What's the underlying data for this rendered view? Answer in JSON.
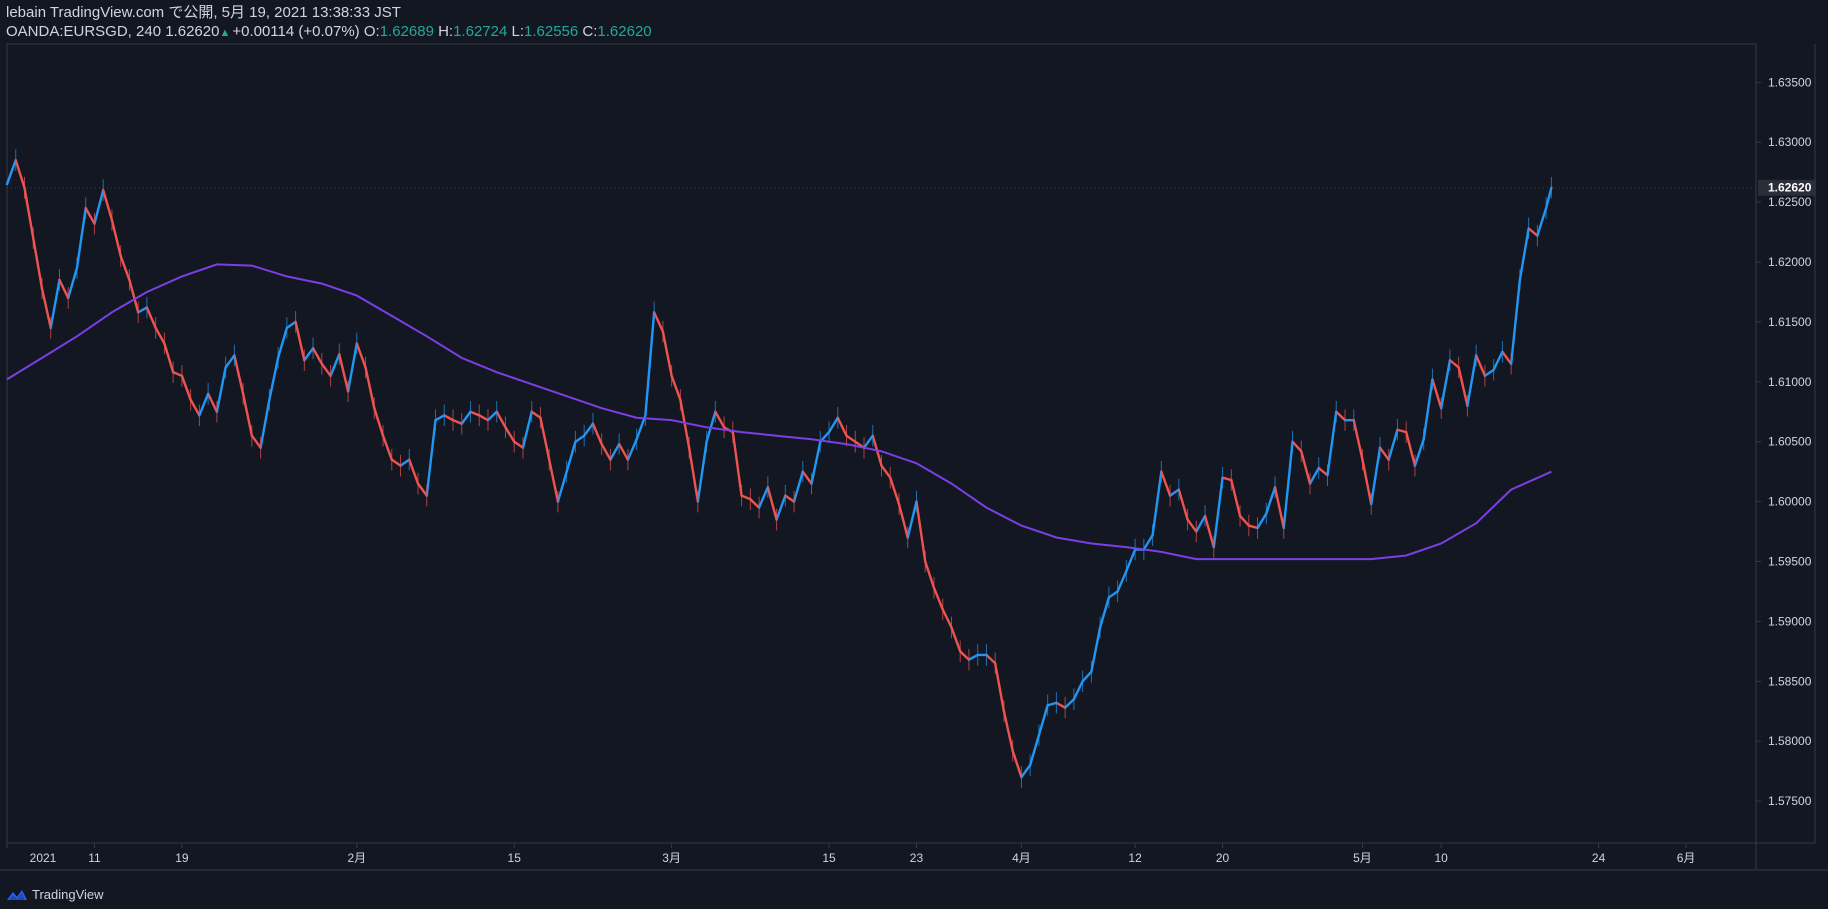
{
  "header": {
    "published_line": "lebain TradingView.com で公開, 5月 19, 2021 13:38:33 JST",
    "symbol": "OANDA:EURSGD, 240",
    "last": "1.62620",
    "change": "+0.00114 (+0.07%)",
    "o_label": "O:",
    "o_value": "1.62689",
    "h_label": "H:",
    "h_value": "1.62724",
    "l_label": "L:",
    "l_value": "1.62556",
    "c_label": "C:",
    "c_value": "1.62620"
  },
  "footer": {
    "brand": "TradingView"
  },
  "colors": {
    "background": "#131722",
    "up": "#2196f3",
    "down": "#ef5350",
    "ma_line": "#7b3fe4",
    "axis_text": "#d1d4dc",
    "border": "#363a45",
    "last_price_badge": "#2a2e39"
  },
  "chart_data": {
    "type": "line",
    "title": "",
    "xlabel": "",
    "ylabel": "",
    "ylim": [
      1.5715,
      1.6382
    ],
    "y_ticks": [
      "1.63500",
      "1.63000",
      "1.62500",
      "1.62000",
      "1.61500",
      "1.61000",
      "1.60500",
      "1.60000",
      "1.59500",
      "1.59000",
      "1.58500",
      "1.58000",
      "1.57500"
    ],
    "last_price_label": "1.62620",
    "x_ticks": [
      {
        "label": "2021",
        "x": 0.0
      },
      {
        "label": "11",
        "x": 0.05
      },
      {
        "label": "19",
        "x": 0.1
      },
      {
        "label": "2月",
        "x": 0.2
      },
      {
        "label": "15",
        "x": 0.29
      },
      {
        "label": "3月",
        "x": 0.38
      },
      {
        "label": "15",
        "x": 0.47
      },
      {
        "label": "23",
        "x": 0.52
      },
      {
        "label": "4月",
        "x": 0.58
      },
      {
        "label": "12",
        "x": 0.645
      },
      {
        "label": "20",
        "x": 0.695
      },
      {
        "label": "5月",
        "x": 0.775
      },
      {
        "label": "10",
        "x": 0.82
      },
      {
        "label": "24",
        "x": 0.91
      },
      {
        "label": "6月",
        "x": 0.96
      }
    ],
    "x_domain": [
      0,
      1
    ],
    "last_bar_x": 0.883,
    "series": [
      {
        "name": "EURSGD",
        "kind": "price",
        "points": [
          [
            0.0,
            1.6265
          ],
          [
            0.005,
            1.6285
          ],
          [
            0.01,
            1.6262
          ],
          [
            0.015,
            1.622
          ],
          [
            0.02,
            1.6178
          ],
          [
            0.025,
            1.6145
          ],
          [
            0.03,
            1.6185
          ],
          [
            0.035,
            1.617
          ],
          [
            0.04,
            1.6195
          ],
          [
            0.045,
            1.6245
          ],
          [
            0.05,
            1.6232
          ],
          [
            0.055,
            1.626
          ],
          [
            0.06,
            1.6235
          ],
          [
            0.065,
            1.6205
          ],
          [
            0.07,
            1.6185
          ],
          [
            0.075,
            1.6158
          ],
          [
            0.08,
            1.6162
          ],
          [
            0.085,
            1.6145
          ],
          [
            0.09,
            1.6132
          ],
          [
            0.095,
            1.6108
          ],
          [
            0.1,
            1.6105
          ],
          [
            0.105,
            1.6085
          ],
          [
            0.11,
            1.6072
          ],
          [
            0.115,
            1.609
          ],
          [
            0.12,
            1.6075
          ],
          [
            0.125,
            1.6112
          ],
          [
            0.13,
            1.6122
          ],
          [
            0.135,
            1.609
          ],
          [
            0.14,
            1.6055
          ],
          [
            0.145,
            1.6045
          ],
          [
            0.15,
            1.6085
          ],
          [
            0.155,
            1.612
          ],
          [
            0.16,
            1.6145
          ],
          [
            0.165,
            1.615
          ],
          [
            0.17,
            1.6118
          ],
          [
            0.175,
            1.6128
          ],
          [
            0.18,
            1.6115
          ],
          [
            0.185,
            1.6105
          ],
          [
            0.19,
            1.6123
          ],
          [
            0.195,
            1.6092
          ],
          [
            0.2,
            1.6132
          ],
          [
            0.205,
            1.6112
          ],
          [
            0.21,
            1.6078
          ],
          [
            0.215,
            1.6055
          ],
          [
            0.22,
            1.6035
          ],
          [
            0.225,
            1.603
          ],
          [
            0.23,
            1.6035
          ],
          [
            0.235,
            1.6015
          ],
          [
            0.24,
            1.6005
          ],
          [
            0.245,
            1.6068
          ],
          [
            0.25,
            1.6072
          ],
          [
            0.255,
            1.6068
          ],
          [
            0.26,
            1.6065
          ],
          [
            0.265,
            1.6075
          ],
          [
            0.27,
            1.6072
          ],
          [
            0.275,
            1.6068
          ],
          [
            0.28,
            1.6075
          ],
          [
            0.285,
            1.6062
          ],
          [
            0.29,
            1.605
          ],
          [
            0.295,
            1.6045
          ],
          [
            0.3,
            1.6075
          ],
          [
            0.305,
            1.607
          ],
          [
            0.31,
            1.6035
          ],
          [
            0.315,
            1.6
          ],
          [
            0.32,
            1.6025
          ],
          [
            0.325,
            1.605
          ],
          [
            0.33,
            1.6055
          ],
          [
            0.335,
            1.6065
          ],
          [
            0.34,
            1.6048
          ],
          [
            0.345,
            1.6035
          ],
          [
            0.35,
            1.6048
          ],
          [
            0.355,
            1.6035
          ],
          [
            0.36,
            1.6052
          ],
          [
            0.365,
            1.6072
          ],
          [
            0.37,
            1.6158
          ],
          [
            0.375,
            1.6142
          ],
          [
            0.38,
            1.6105
          ],
          [
            0.385,
            1.6085
          ],
          [
            0.39,
            1.6045
          ],
          [
            0.395,
            1.6
          ],
          [
            0.4,
            1.605
          ],
          [
            0.405,
            1.6075
          ],
          [
            0.41,
            1.6062
          ],
          [
            0.415,
            1.6058
          ],
          [
            0.42,
            1.6005
          ],
          [
            0.425,
            1.6002
          ],
          [
            0.43,
            1.5995
          ],
          [
            0.435,
            1.6012
          ],
          [
            0.44,
            1.5985
          ],
          [
            0.445,
            1.6005
          ],
          [
            0.45,
            1.6
          ],
          [
            0.455,
            1.6025
          ],
          [
            0.46,
            1.6015
          ],
          [
            0.465,
            1.605
          ],
          [
            0.47,
            1.6058
          ],
          [
            0.475,
            1.607
          ],
          [
            0.48,
            1.6055
          ],
          [
            0.485,
            1.605
          ],
          [
            0.49,
            1.6045
          ],
          [
            0.495,
            1.6055
          ],
          [
            0.5,
            1.603
          ],
          [
            0.505,
            1.602
          ],
          [
            0.51,
            1.5998
          ],
          [
            0.515,
            1.597
          ],
          [
            0.52,
            1.6
          ],
          [
            0.525,
            1.595
          ],
          [
            0.53,
            1.5928
          ],
          [
            0.535,
            1.591
          ],
          [
            0.54,
            1.5895
          ],
          [
            0.545,
            1.5875
          ],
          [
            0.55,
            1.5868
          ],
          [
            0.555,
            1.5872
          ],
          [
            0.56,
            1.5872
          ],
          [
            0.565,
            1.5865
          ],
          [
            0.57,
            1.5825
          ],
          [
            0.575,
            1.5792
          ],
          [
            0.58,
            1.577
          ],
          [
            0.585,
            1.578
          ],
          [
            0.59,
            1.5805
          ],
          [
            0.595,
            1.583
          ],
          [
            0.6,
            1.5832
          ],
          [
            0.605,
            1.5828
          ],
          [
            0.61,
            1.5835
          ],
          [
            0.615,
            1.585
          ],
          [
            0.62,
            1.5858
          ],
          [
            0.625,
            1.5895
          ],
          [
            0.63,
            1.592
          ],
          [
            0.635,
            1.5925
          ],
          [
            0.64,
            1.5942
          ],
          [
            0.645,
            1.596
          ],
          [
            0.65,
            1.596
          ],
          [
            0.655,
            1.5972
          ],
          [
            0.66,
            1.6025
          ],
          [
            0.665,
            1.6005
          ],
          [
            0.67,
            1.601
          ],
          [
            0.675,
            1.5985
          ],
          [
            0.68,
            1.5975
          ],
          [
            0.685,
            1.5988
          ],
          [
            0.69,
            1.5962
          ],
          [
            0.695,
            1.602
          ],
          [
            0.7,
            1.6018
          ],
          [
            0.705,
            1.5988
          ],
          [
            0.71,
            1.598
          ],
          [
            0.715,
            1.5978
          ],
          [
            0.72,
            1.599
          ],
          [
            0.725,
            1.6012
          ],
          [
            0.73,
            1.5978
          ],
          [
            0.735,
            1.605
          ],
          [
            0.74,
            1.6042
          ],
          [
            0.745,
            1.6015
          ],
          [
            0.75,
            1.6028
          ],
          [
            0.755,
            1.6022
          ],
          [
            0.76,
            1.6075
          ],
          [
            0.765,
            1.6068
          ],
          [
            0.77,
            1.6068
          ],
          [
            0.775,
            1.6035
          ],
          [
            0.78,
            1.5998
          ],
          [
            0.785,
            1.6045
          ],
          [
            0.79,
            1.6035
          ],
          [
            0.795,
            1.606
          ],
          [
            0.8,
            1.6058
          ],
          [
            0.805,
            1.603
          ],
          [
            0.81,
            1.6052
          ],
          [
            0.815,
            1.6102
          ],
          [
            0.82,
            1.6078
          ],
          [
            0.825,
            1.6118
          ],
          [
            0.83,
            1.6112
          ],
          [
            0.835,
            1.608
          ],
          [
            0.84,
            1.6122
          ],
          [
            0.845,
            1.6105
          ],
          [
            0.85,
            1.611
          ],
          [
            0.855,
            1.6125
          ],
          [
            0.86,
            1.6115
          ],
          [
            0.865,
            1.6185
          ],
          [
            0.87,
            1.6228
          ],
          [
            0.875,
            1.6222
          ],
          [
            0.88,
            1.6245
          ],
          [
            0.883,
            1.6262
          ]
        ]
      },
      {
        "name": "MA",
        "kind": "line",
        "points": [
          [
            0.0,
            1.6102
          ],
          [
            0.02,
            1.612
          ],
          [
            0.04,
            1.6138
          ],
          [
            0.06,
            1.6158
          ],
          [
            0.08,
            1.6175
          ],
          [
            0.1,
            1.6188
          ],
          [
            0.12,
            1.6198
          ],
          [
            0.14,
            1.6197
          ],
          [
            0.16,
            1.6188
          ],
          [
            0.18,
            1.6182
          ],
          [
            0.2,
            1.6172
          ],
          [
            0.22,
            1.6155
          ],
          [
            0.24,
            1.6138
          ],
          [
            0.26,
            1.612
          ],
          [
            0.28,
            1.6108
          ],
          [
            0.3,
            1.6098
          ],
          [
            0.32,
            1.6088
          ],
          [
            0.34,
            1.6078
          ],
          [
            0.36,
            1.607
          ],
          [
            0.38,
            1.6068
          ],
          [
            0.4,
            1.6062
          ],
          [
            0.42,
            1.6058
          ],
          [
            0.44,
            1.6055
          ],
          [
            0.46,
            1.6052
          ],
          [
            0.48,
            1.6048
          ],
          [
            0.5,
            1.6042
          ],
          [
            0.52,
            1.6032
          ],
          [
            0.54,
            1.6015
          ],
          [
            0.56,
            1.5995
          ],
          [
            0.58,
            1.598
          ],
          [
            0.6,
            1.597
          ],
          [
            0.62,
            1.5965
          ],
          [
            0.64,
            1.5962
          ],
          [
            0.66,
            1.5958
          ],
          [
            0.68,
            1.5952
          ],
          [
            0.7,
            1.5952
          ],
          [
            0.72,
            1.5952
          ],
          [
            0.74,
            1.5952
          ],
          [
            0.76,
            1.5952
          ],
          [
            0.78,
            1.5952
          ],
          [
            0.8,
            1.5955
          ],
          [
            0.82,
            1.5965
          ],
          [
            0.84,
            1.5982
          ],
          [
            0.86,
            1.601
          ],
          [
            0.883,
            1.6025
          ]
        ]
      }
    ]
  }
}
